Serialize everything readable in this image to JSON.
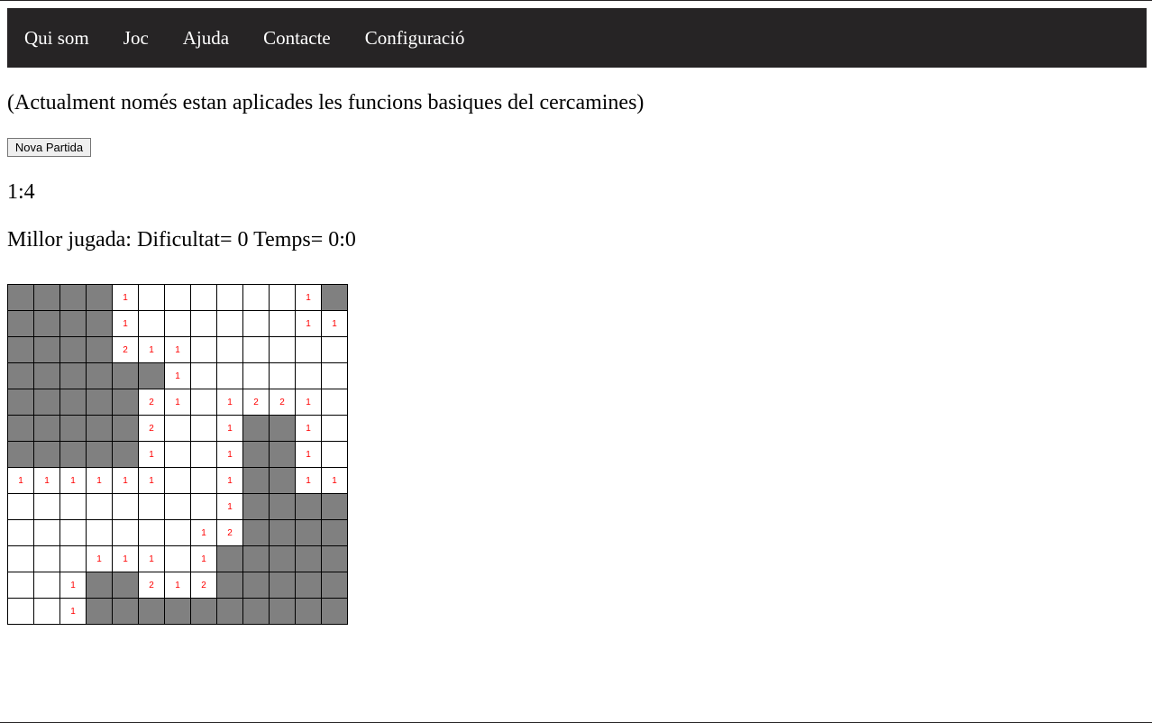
{
  "nav": {
    "items": [
      "Qui som",
      "Joc",
      "Ajuda",
      "Contacte",
      "Configuració"
    ]
  },
  "note": "(Actualment només estan aplicades les funcions basiques del cercamines)",
  "new_game_label": "Nova Partida",
  "timer": "1:4",
  "best_play": {
    "label": "Millor jugada:",
    "difficulty_label": "Dificultat=",
    "difficulty_value": "0",
    "time_label": "Temps=",
    "time_value": "0:0"
  },
  "colors": {
    "navbar": "#262425",
    "hidden_cell": "#808080",
    "number": "#ff0000"
  },
  "board": {
    "rows": 13,
    "cols": 13,
    "hidden_marker": "#",
    "cells": [
      [
        "#",
        "#",
        "#",
        "#",
        "1",
        "",
        "",
        "",
        "",
        "",
        "",
        "1",
        "#"
      ],
      [
        "#",
        "#",
        "#",
        "#",
        "1",
        "",
        "",
        "",
        "",
        "",
        "",
        "1",
        "1"
      ],
      [
        "#",
        "#",
        "#",
        "#",
        "2",
        "1",
        "1",
        "",
        "",
        "",
        "",
        "",
        ""
      ],
      [
        "#",
        "#",
        "#",
        "#",
        "#",
        "#",
        "1",
        "",
        "",
        "",
        "",
        "",
        ""
      ],
      [
        "#",
        "#",
        "#",
        "#",
        "#",
        "2",
        "1",
        "",
        "1",
        "2",
        "2",
        "1",
        ""
      ],
      [
        "#",
        "#",
        "#",
        "#",
        "#",
        "2",
        "",
        "",
        "1",
        "#",
        "#",
        "1",
        ""
      ],
      [
        "#",
        "#",
        "#",
        "#",
        "#",
        "1",
        "",
        "",
        "1",
        "#",
        "#",
        "1",
        ""
      ],
      [
        "1",
        "1",
        "1",
        "1",
        "1",
        "1",
        "",
        "",
        "1",
        "#",
        "#",
        "1",
        "1"
      ],
      [
        "",
        "",
        "",
        "",
        "",
        "",
        "",
        "",
        "1",
        "#",
        "#",
        "#",
        "#"
      ],
      [
        "",
        "",
        "",
        "",
        "",
        "",
        "",
        "1",
        "2",
        "#",
        "#",
        "#",
        "#"
      ],
      [
        "",
        "",
        "",
        "1",
        "1",
        "1",
        "",
        "1",
        "#",
        "#",
        "#",
        "#",
        "#"
      ],
      [
        "",
        "",
        "1",
        "#",
        "#",
        "2",
        "1",
        "2",
        "#",
        "#",
        "#",
        "#",
        "#"
      ],
      [
        "",
        "",
        "1",
        "#",
        "#",
        "#",
        "#",
        "#",
        "#",
        "#",
        "#",
        "#",
        "#"
      ]
    ]
  }
}
